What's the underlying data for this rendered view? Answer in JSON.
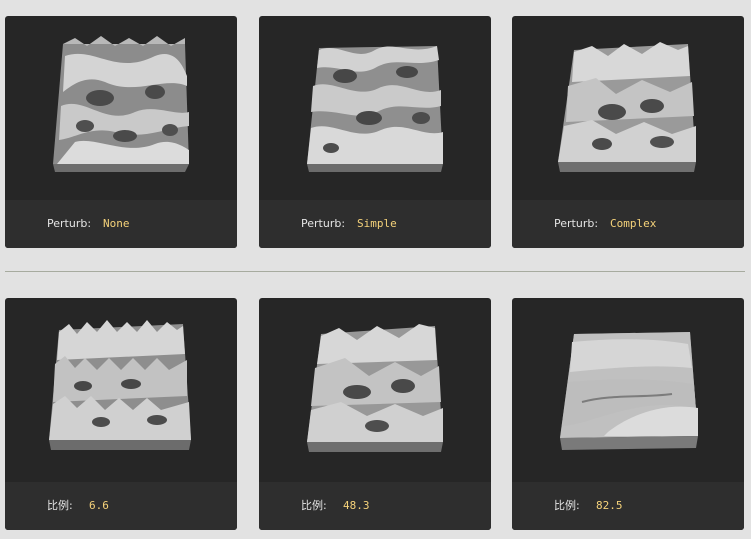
{
  "row1": [
    {
      "label": "Perturb:",
      "value": "None"
    },
    {
      "label": "Perturb:",
      "value": "Simple"
    },
    {
      "label": "Perturb:",
      "value": "Complex"
    }
  ],
  "row2": [
    {
      "label": "比例:",
      "value": "6.6"
    },
    {
      "label": "比例:",
      "value": "48.3"
    },
    {
      "label": "比例:",
      "value": "82.5"
    }
  ],
  "colors": {
    "page_background": "#e2e2e2",
    "card_background": "#262626",
    "caption_background": "#2e2e2e",
    "label_text": "#e4e4e4",
    "value_text": "#f5d27a",
    "divider": "#a7ab9f"
  }
}
